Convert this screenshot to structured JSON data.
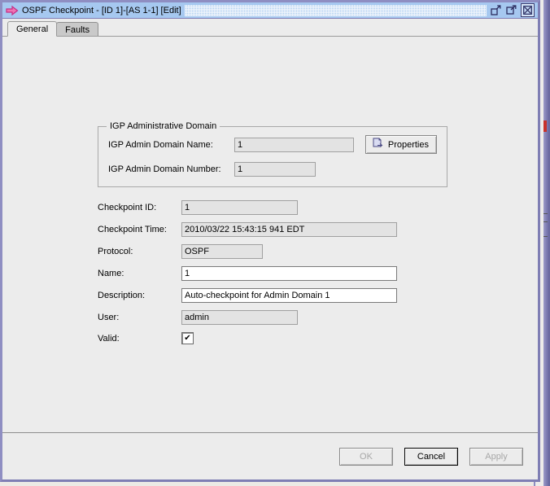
{
  "window": {
    "title": "OSPF Checkpoint - [ID 1]-[AS 1-1] [Edit]",
    "title_icon": "pink-arrow-icon",
    "controls": {
      "minimize_label": "minimize-icon",
      "maximize_label": "maximize-icon",
      "close_label": "close-icon"
    }
  },
  "tabs": [
    {
      "label": "General",
      "active": true
    },
    {
      "label": "Faults",
      "active": false
    }
  ],
  "group": {
    "title": "IGP Administrative Domain",
    "fields": [
      {
        "label": "IGP Admin Domain Name:",
        "value": "1",
        "readonly": true
      },
      {
        "label": "IGP Admin Domain Number:",
        "value": "1",
        "readonly": true
      }
    ],
    "properties_button": "Properties",
    "properties_icon": "document-properties-icon"
  },
  "form": {
    "checkpoint_id": {
      "label": "Checkpoint ID:",
      "value": "1"
    },
    "checkpoint_time": {
      "label": "Checkpoint Time:",
      "value": "2010/03/22 15:43:15 941 EDT"
    },
    "protocol": {
      "label": "Protocol:",
      "value": "OSPF"
    },
    "name": {
      "label": "Name:",
      "value": "1"
    },
    "description": {
      "label": "Description:",
      "value": "Auto-checkpoint for Admin Domain 1"
    },
    "user": {
      "label": "User:",
      "value": "admin"
    },
    "valid": {
      "label": "Valid:",
      "checked": true,
      "check_glyph": "✔"
    }
  },
  "buttons": {
    "ok": "OK",
    "cancel": "Cancel",
    "apply": "Apply"
  },
  "colors": {
    "titlebar": "#a6c8f0",
    "window_frame": "#7f7eb4",
    "panel": "#ececec",
    "field_readonly": "#e3e3e3",
    "field_editable": "#ffffff",
    "title_icon": "#e8599f"
  }
}
